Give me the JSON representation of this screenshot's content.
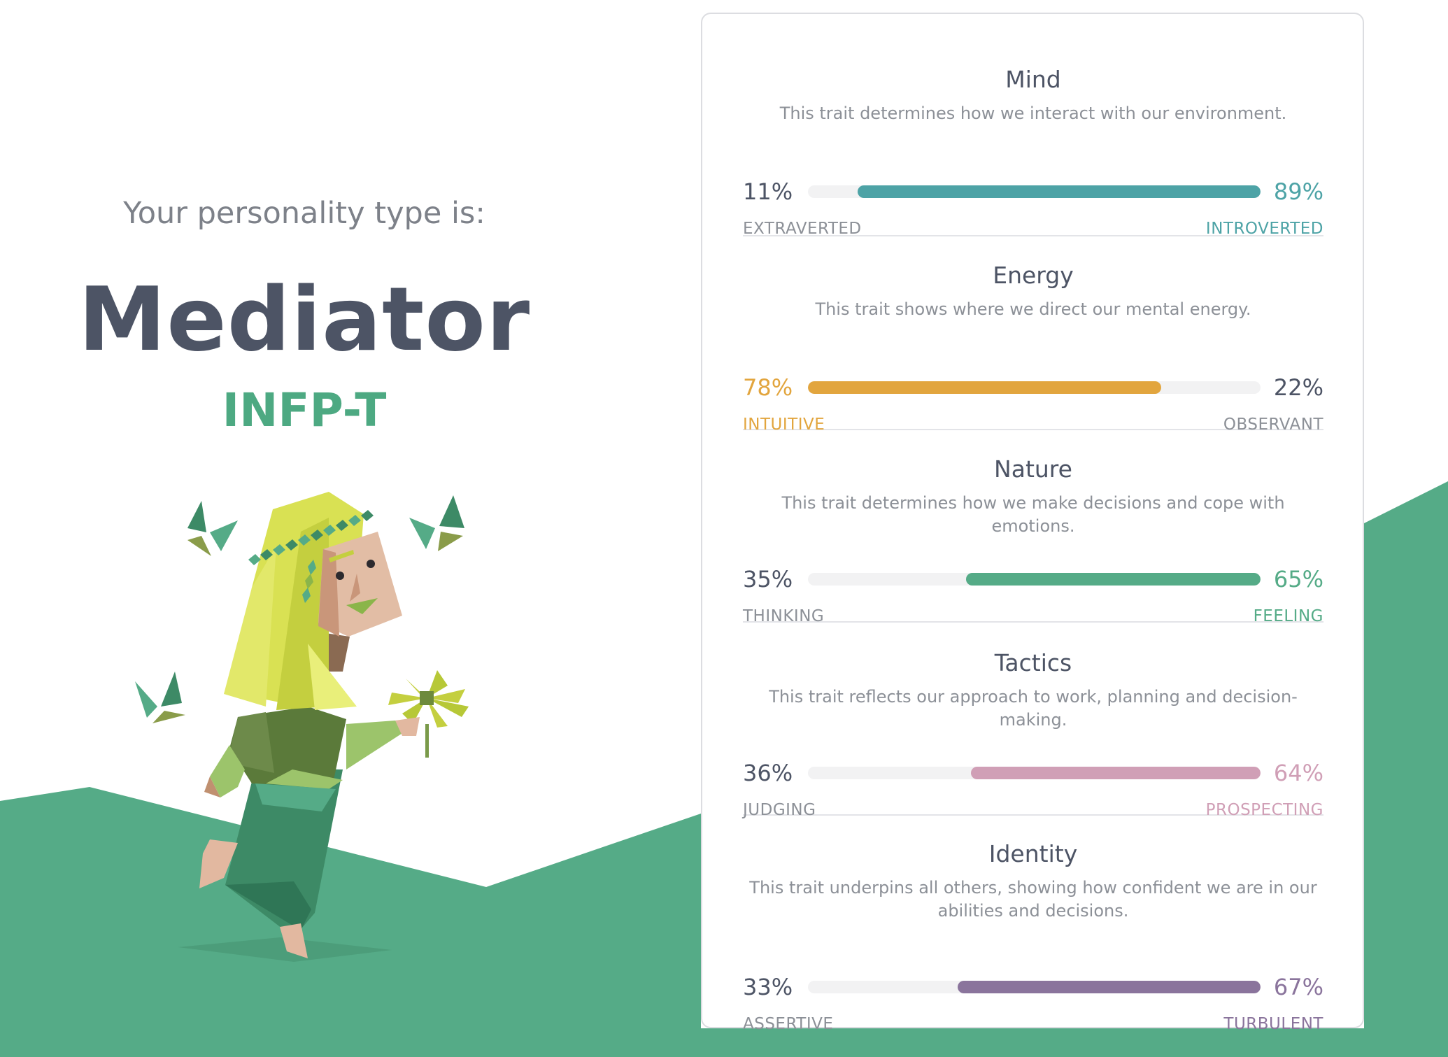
{
  "header": {
    "intro": "Your personality type is:",
    "type_name": "Mediator",
    "type_code": "INFP-T"
  },
  "colors": {
    "green": "#55ab87",
    "dark_text": "#4d5465",
    "muted_text": "#8c9097"
  },
  "illustration": "mediator-character-illustration",
  "traits": [
    {
      "title": "Mind",
      "description": [
        "This trait determines how we interact with our environment."
      ],
      "left_label": "EXTRAVERTED",
      "left_percent": "11%",
      "right_label": "INTROVERTED",
      "right_percent": "89%",
      "dominant": "right",
      "dominant_value": 89,
      "color": "#4da3a6"
    },
    {
      "title": "Energy",
      "description": [
        "This trait shows where we direct our mental energy."
      ],
      "left_label": "INTUITIVE",
      "left_percent": "78%",
      "right_label": "OBSERVANT",
      "right_percent": "22%",
      "dominant": "left",
      "dominant_value": 78,
      "color": "#e2a53e"
    },
    {
      "title": "Nature",
      "description": [
        "This trait determines how we make decisions and cope with emotions."
      ],
      "left_label": "THINKING",
      "left_percent": "35%",
      "right_label": "FEELING",
      "right_percent": "65%",
      "dominant": "right",
      "dominant_value": 65,
      "color": "#55ab87"
    },
    {
      "title": "Tactics",
      "description": [
        "This trait reflects our approach to work, planning and decision-making."
      ],
      "left_label": "JUDGING",
      "left_percent": "36%",
      "right_label": "PROSPECTING",
      "right_percent": "64%",
      "dominant": "right",
      "dominant_value": 64,
      "color": "#d09fb6"
    },
    {
      "title": "Identity",
      "description": [
        "This trait underpins all others, showing how confident we are in our",
        "abilities and decisions."
      ],
      "left_label": "ASSERTIVE",
      "left_percent": "33%",
      "right_label": "TURBULENT",
      "right_percent": "67%",
      "dominant": "right",
      "dominant_value": 67,
      "color": "#8a749c"
    }
  ]
}
